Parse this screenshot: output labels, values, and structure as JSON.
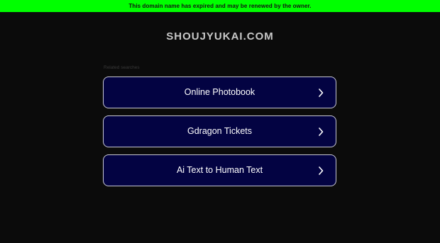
{
  "banner": {
    "text": "This domain name has expired and may be renewed by the owner.",
    "background_color": "#00ff00"
  },
  "header": {
    "domain": "SHOUJYUKAI.COM"
  },
  "related": {
    "label": "Related searches",
    "items": [
      {
        "label": "Online Photobook",
        "icon": "chevron-right-icon"
      },
      {
        "label": "Gdragon Tickets",
        "icon": "chevron-right-icon"
      },
      {
        "label": "Ai Text to Human Text",
        "icon": "chevron-right-icon"
      }
    ]
  },
  "colors": {
    "page_background": "#0b0b0b",
    "button_background": "#030342",
    "button_border": "#c9c9d6"
  }
}
